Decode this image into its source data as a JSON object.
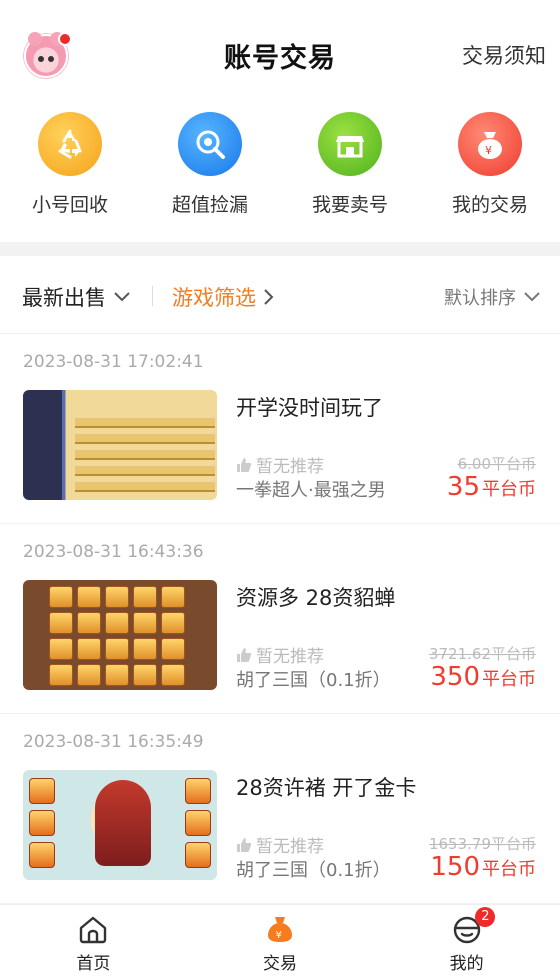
{
  "header": {
    "title": "账号交易",
    "notice": "交易须知"
  },
  "quick_menu": [
    {
      "label": "小号回收",
      "icon": "recycle-icon"
    },
    {
      "label": "超值捡漏",
      "icon": "magnifier-icon"
    },
    {
      "label": "我要卖号",
      "icon": "storefront-icon"
    },
    {
      "label": "我的交易",
      "icon": "money-bag-icon"
    }
  ],
  "filter": {
    "latest": "最新出售",
    "game_filter": "游戏筛选",
    "sort": "默认排序"
  },
  "listings": [
    {
      "time": "2023-08-31 17:02:41",
      "title": "开学没时间玩了",
      "recommend": "暂无推荐",
      "game": "一拳超人·最强之男",
      "original_price": "6.00平台币",
      "price": "35",
      "unit": "平台币"
    },
    {
      "time": "2023-08-31 16:43:36",
      "title": "资源多 28资貂蝉",
      "recommend": "暂无推荐",
      "game": "胡了三国（0.1折）",
      "original_price": "3721.62平台币",
      "price": "350",
      "unit": "平台币"
    },
    {
      "time": "2023-08-31 16:35:49",
      "title": "28资许褚 开了金卡",
      "recommend": "暂无推荐",
      "game": "胡了三国（0.1折）",
      "original_price": "1653.79平台币",
      "price": "150",
      "unit": "平台币"
    }
  ],
  "tabbar": [
    {
      "label": "首页",
      "icon": "home-icon"
    },
    {
      "label": "交易",
      "icon": "trade-bag-icon",
      "active": true
    },
    {
      "label": "我的",
      "icon": "profile-icon",
      "badge": "2"
    }
  ],
  "colors": {
    "accent": "#f57c1f",
    "price": "#f23b2f",
    "badge": "#ee2a2a"
  }
}
